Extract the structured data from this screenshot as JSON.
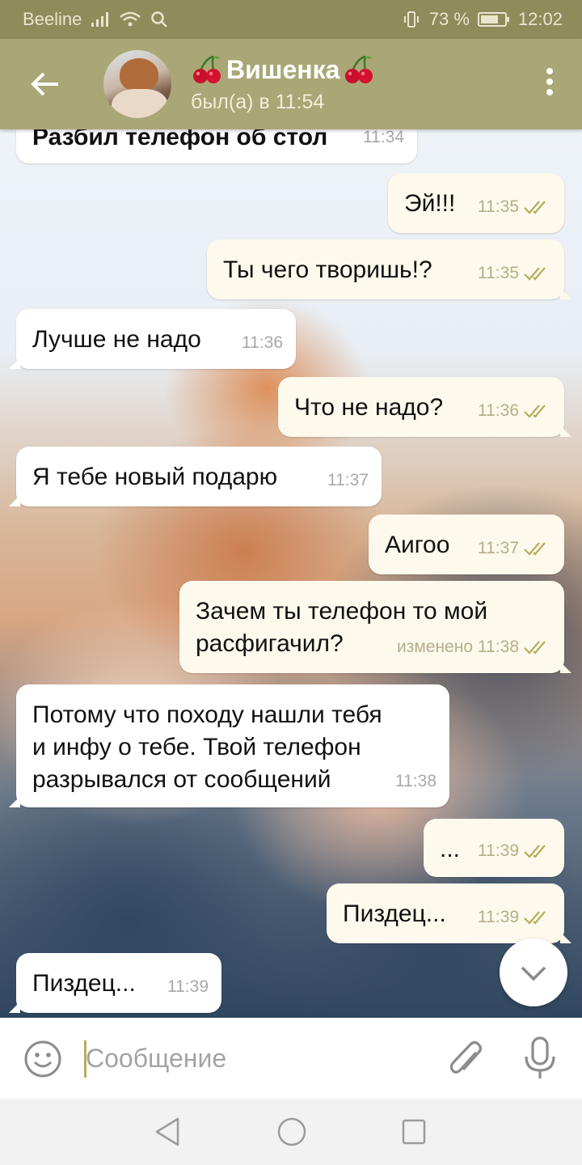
{
  "status_bar": {
    "carrier": "Beeline",
    "battery": "73 %",
    "time": "12:02"
  },
  "header": {
    "contact_name": "Вишенка",
    "last_seen": "был(а) в 11:54",
    "icons": [
      "back-arrow-icon",
      "avatar",
      "cherry-icon",
      "more-vert-icon"
    ]
  },
  "messages": [
    {
      "dir": "in",
      "text": "Разбил телефон об стол",
      "time": "11:34",
      "edited": ""
    },
    {
      "dir": "out",
      "text": "Эй!!!",
      "time": "11:35",
      "edited": ""
    },
    {
      "dir": "out",
      "text": "Ты чего творишь!?",
      "time": "11:35",
      "edited": ""
    },
    {
      "dir": "in",
      "text": "Лучше не надо",
      "time": "11:36",
      "edited": ""
    },
    {
      "dir": "out",
      "text": "Что не надо?",
      "time": "11:36",
      "edited": ""
    },
    {
      "dir": "in",
      "text": "Я тебе новый подарю",
      "time": "11:37",
      "edited": ""
    },
    {
      "dir": "out",
      "text": "Аигоо",
      "time": "11:37",
      "edited": ""
    },
    {
      "dir": "out",
      "text": "Зачем ты телефон то мой\nрасфигачил?",
      "time": "11:38",
      "edited": "изменено"
    },
    {
      "dir": "in",
      "text": "Потому что походу нашли тебя\nи инфу о тебе. Твой телефон\nразрывался от сообщений",
      "time": "11:38",
      "edited": ""
    },
    {
      "dir": "out",
      "text": "...",
      "time": "11:39",
      "edited": ""
    },
    {
      "dir": "out",
      "text": "Пиздец...",
      "time": "11:39",
      "edited": ""
    },
    {
      "dir": "in",
      "text": "Пиздец...",
      "time": "11:39",
      "edited": ""
    }
  ],
  "input": {
    "placeholder": "Сообщение",
    "value": ""
  },
  "colors": {
    "header": "#a9a776",
    "status_bar": "#8e8c5b",
    "outgoing_bubble": "#fdf9ec",
    "incoming_bubble": "#ffffff",
    "read_ticks": "#b5ae5a"
  }
}
